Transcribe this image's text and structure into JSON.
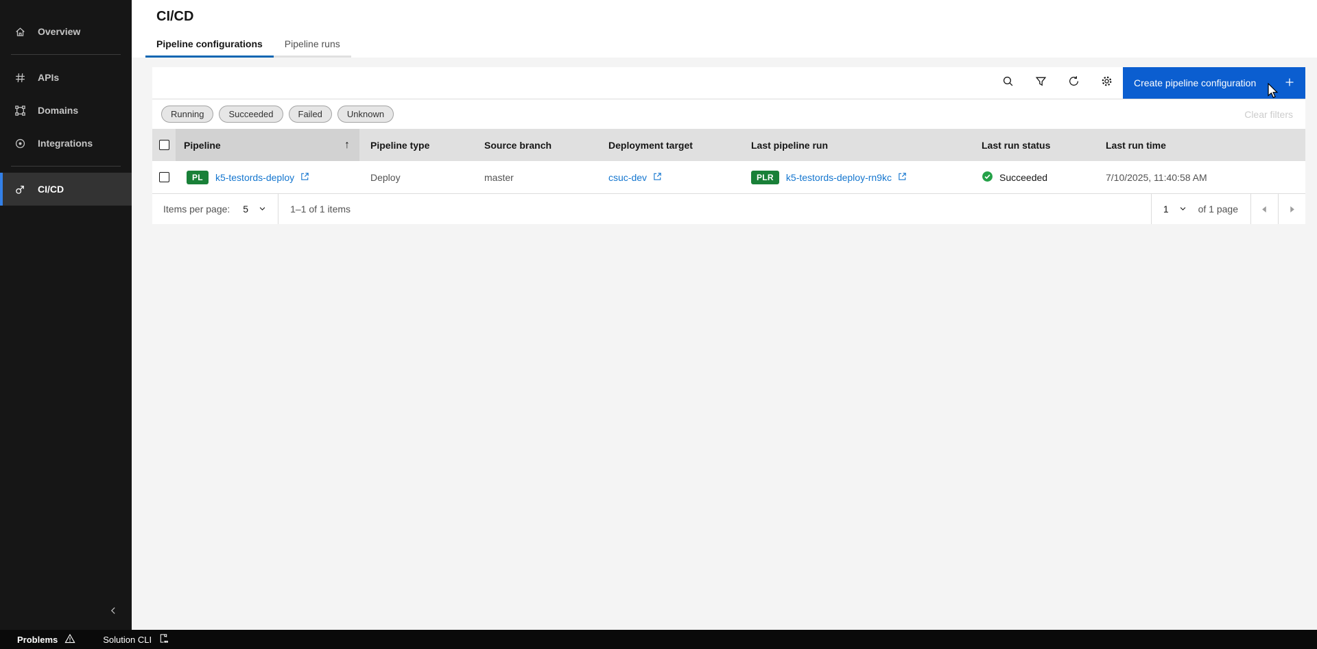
{
  "colors": {
    "accent": "#0a66b2",
    "link": "#1476cf",
    "tag_green": "#198038",
    "success": "#24a148",
    "sidebar_active_border": "#3380e8",
    "button_blue": "#0b5ed0"
  },
  "sidebar": {
    "items": [
      {
        "label": "Overview",
        "icon": "home-icon"
      },
      {
        "label": "APIs",
        "icon": "api-icon"
      },
      {
        "label": "Domains",
        "icon": "domains-icon"
      },
      {
        "label": "Integrations",
        "icon": "integrations-icon"
      },
      {
        "label": "CI/CD",
        "icon": "cicd-icon",
        "active": true
      }
    ]
  },
  "header": {
    "title": "CI/CD",
    "tabs": [
      {
        "label": "Pipeline configurations",
        "active": true
      },
      {
        "label": "Pipeline runs"
      }
    ]
  },
  "toolbar": {
    "icons": [
      "search-icon",
      "filter-icon",
      "refresh-icon",
      "settings-icon"
    ],
    "create_label": "Create pipeline configuration"
  },
  "filters": {
    "tags": [
      "Running",
      "Succeeded",
      "Failed",
      "Unknown"
    ],
    "clear_label": "Clear filters"
  },
  "table": {
    "columns": [
      "",
      "Pipeline",
      "Pipeline type",
      "Source branch",
      "Deployment target",
      "Last pipeline run",
      "Last run status",
      "Last run time"
    ],
    "sort_glyph": "↑",
    "rows": [
      {
        "pipeline_tag": "PL",
        "pipeline_name": "k5-testords-deploy",
        "type": "Deploy",
        "source_branch": "master",
        "deployment_target": "csuc-dev",
        "run_tag": "PLR",
        "run_name": "k5-testords-deploy-rn9kc",
        "status": "Succeeded",
        "time": "7/10/2025, 11:40:58 AM"
      }
    ]
  },
  "pagination": {
    "items_per_page_label": "Items per page:",
    "page_size": "5",
    "range": "1–1 of 1 items",
    "page_number": "1",
    "page_count_label": "of 1 page"
  },
  "statusbar": {
    "problems_label": "Problems",
    "cli_label": "Solution CLI"
  }
}
